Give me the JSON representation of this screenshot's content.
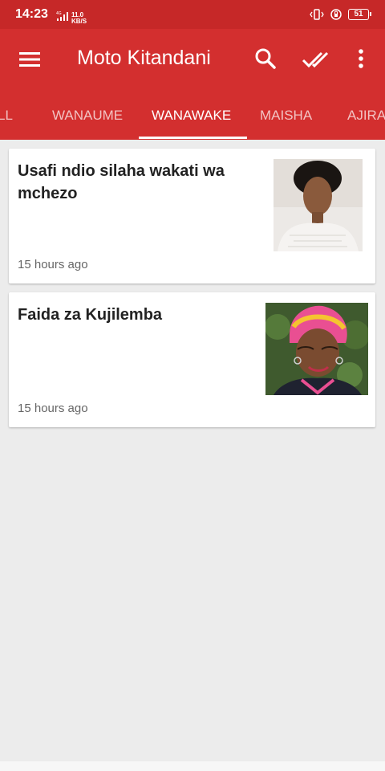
{
  "status_bar": {
    "time": "14:23",
    "network": "4G",
    "speed_value": "11.0",
    "speed_unit": "KB/S",
    "battery": "51"
  },
  "app_bar": {
    "title": "Moto Kitandani",
    "icons": [
      "menu-icon",
      "search-icon",
      "double-check-icon",
      "more-vert-icon"
    ]
  },
  "tabs": [
    {
      "label": "LL",
      "active": false
    },
    {
      "label": "WANAUME",
      "active": false
    },
    {
      "label": "WANAWAKE",
      "active": true
    },
    {
      "label": "MAISHA",
      "active": false
    },
    {
      "label": "AJIRA",
      "active": false
    }
  ],
  "articles": [
    {
      "title": "Usafi ndio silaha wakati wa mchezo",
      "time": "15 hours ago"
    },
    {
      "title": "Faida za Kujilemba",
      "time": "15 hours ago"
    }
  ],
  "colors": {
    "primary": "#d32f2f",
    "status": "#c62828",
    "background": "#ececec"
  }
}
